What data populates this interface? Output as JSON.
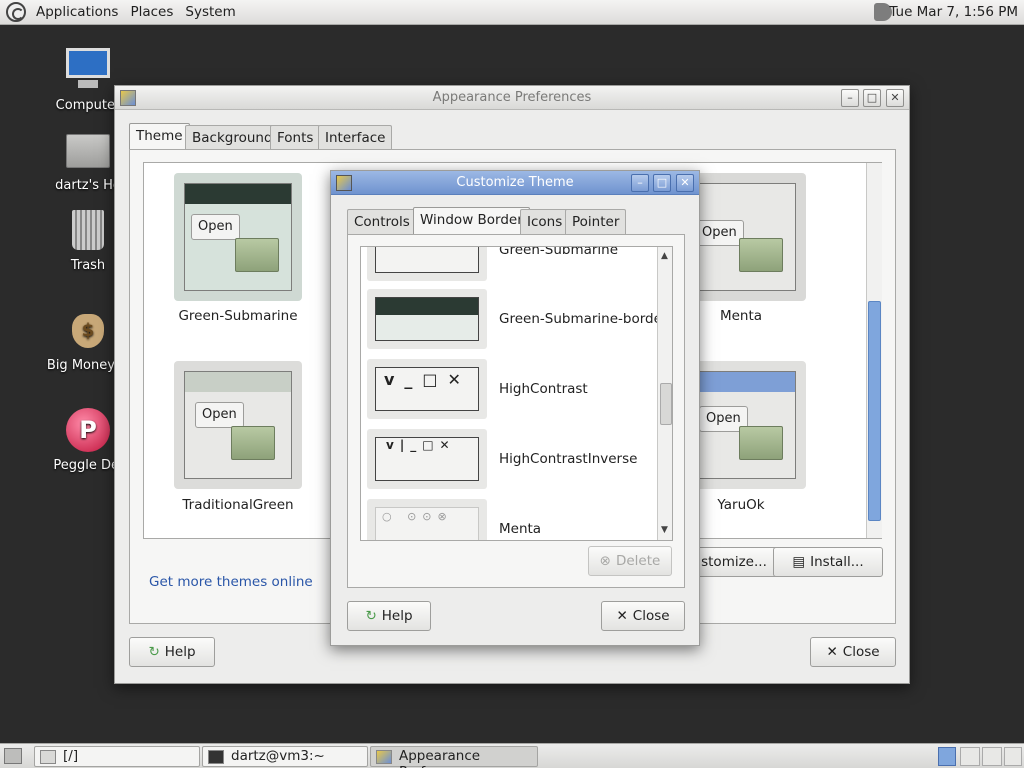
{
  "top_panel": {
    "menus": [
      "Applications",
      "Places",
      "System"
    ],
    "clock": "Tue Mar  7,  1:56 PM"
  },
  "desktop_icons": [
    {
      "label": "Computer"
    },
    {
      "label": "dartz's Ho"
    },
    {
      "label": "Trash"
    },
    {
      "label": "Big Money D"
    },
    {
      "label": "Peggle Del"
    }
  ],
  "appearance": {
    "title": "Appearance Preferences",
    "tabs": [
      "Theme",
      "Background",
      "Fonts",
      "Interface"
    ],
    "active_tab": "Theme",
    "themes": [
      {
        "name": "Green-Submarine",
        "open": "Open"
      },
      {
        "name": "Menta",
        "open": "Open"
      },
      {
        "name": "TraditionalGreen",
        "open": "Open"
      },
      {
        "name": "YaruOk",
        "open": "Open"
      }
    ],
    "customize_label": "stomize...",
    "install_label": "Install...",
    "more_themes_link": "Get more themes online",
    "help_label": "Help",
    "close_label": "Close"
  },
  "customize": {
    "title": "Customize Theme",
    "tabs": [
      "Controls",
      "Window Border",
      "Icons",
      "Pointer"
    ],
    "active_tab": "Window Border",
    "borders": [
      "Green-Submarine",
      "Green-Submarine-border",
      "HighContrast",
      "HighContrastInverse",
      "Menta"
    ],
    "delete_label": "Delete",
    "help_label": "Help",
    "close_label": "Close"
  },
  "taskbar": {
    "tasks": [
      "[/]",
      "dartz@vm3:~",
      "Appearance Prefere..."
    ]
  },
  "colors": {
    "accent": "#7fa6dd",
    "link": "#2a56a8",
    "titlebar_blue": "#7e9fd6"
  }
}
